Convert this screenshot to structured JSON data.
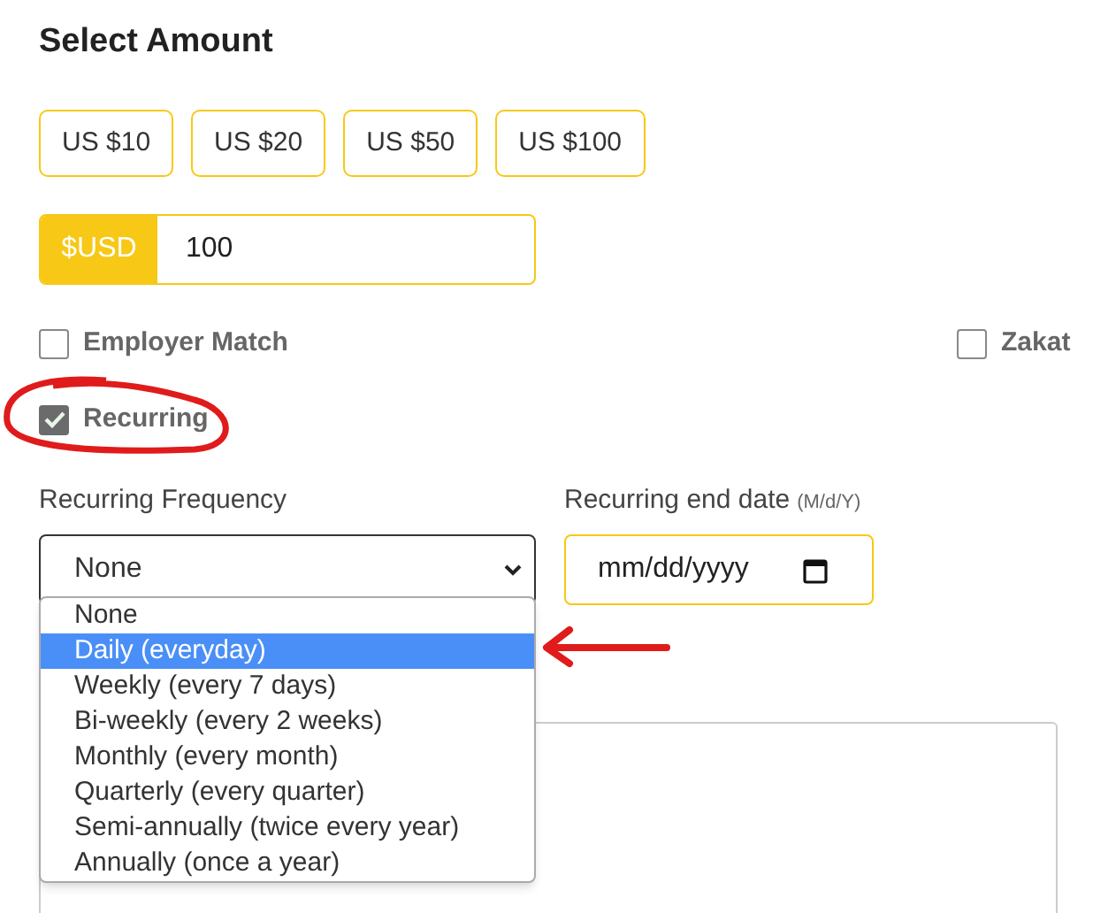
{
  "title": "Select Amount",
  "amount_buttons": [
    "US $10",
    "US $20",
    "US $50",
    "US $100"
  ],
  "amount_field": {
    "currency": "$USD",
    "value": "100"
  },
  "options": [
    {
      "label": "Employer Match",
      "checked": false
    },
    {
      "label": "Zakat",
      "checked": false
    },
    {
      "label": "Recurring",
      "checked": true
    }
  ],
  "frequency": {
    "label": "Recurring Frequency",
    "value": "None",
    "expanded": true,
    "choices": [
      {
        "label": "None",
        "highlighted": false
      },
      {
        "label": "Daily (everyday)",
        "highlighted": true
      },
      {
        "label": "Weekly (every 7 days)",
        "highlighted": false
      },
      {
        "label": "Bi-weekly (every 2 weeks)",
        "highlighted": false
      },
      {
        "label": "Monthly (every month)",
        "highlighted": false
      },
      {
        "label": "Quarterly (every quarter)",
        "highlighted": false
      },
      {
        "label": "Semi-annually (twice every year)",
        "highlighted": false
      },
      {
        "label": "Annually (once a year)",
        "highlighted": false
      }
    ]
  },
  "end_date": {
    "label": "Recurring end date",
    "hint": "(M/d/Y)",
    "placeholder": "mm/dd/yyyy"
  }
}
